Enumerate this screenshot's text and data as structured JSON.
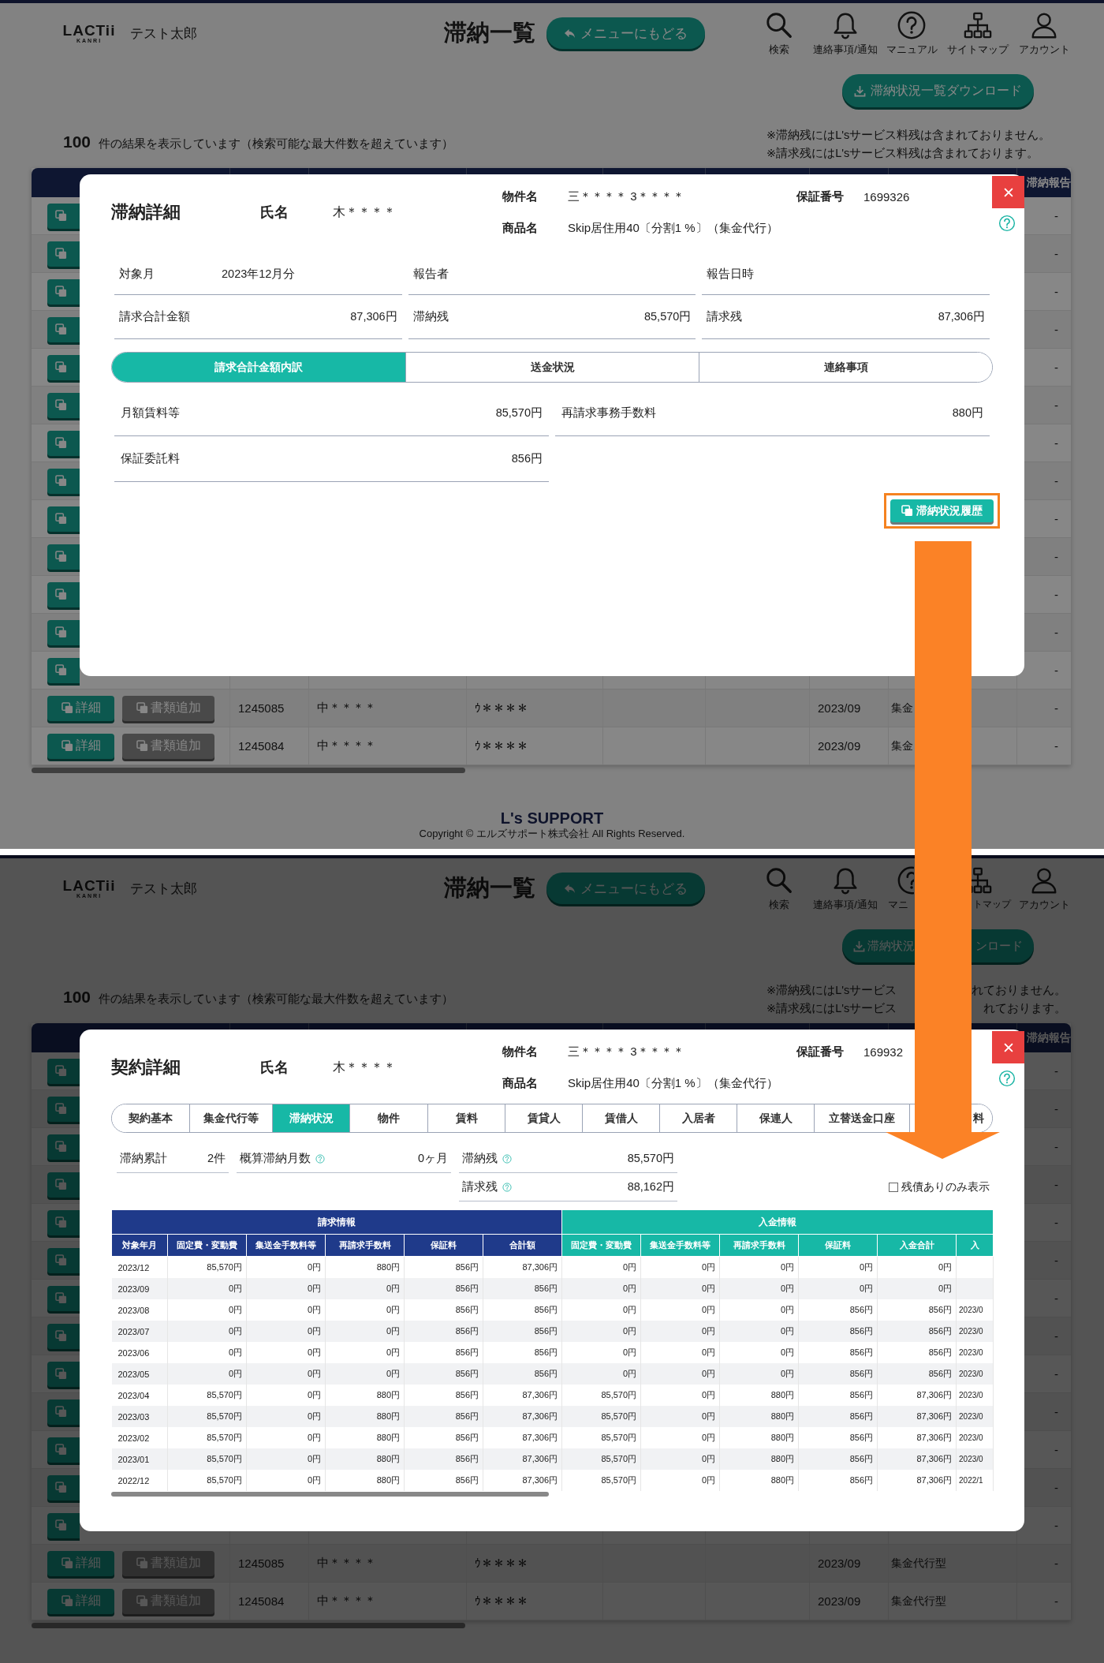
{
  "panels": [
    {
      "header": {
        "logo": "LACTii",
        "logo_sub": "KANRI",
        "user": "テスト太郎",
        "title": "滞納一覧",
        "back_button": "メニューにもどる",
        "nav": [
          {
            "kind": "search",
            "label": "検索"
          },
          {
            "kind": "bell",
            "label": "連絡事項/通知"
          },
          {
            "kind": "help",
            "label": "マニュアル"
          },
          {
            "kind": "sitemap",
            "label": "サイトマップ"
          },
          {
            "kind": "account",
            "label": "アカウント"
          }
        ]
      },
      "download_button": [
        "滞納状況一覧ダウンロード"
      ],
      "result_text": "**100** 件の結果を表示しています（検索可能な最大件数を超えています）",
      "notes": [
        [
          "※滞納残にはL'sサービス料残は含まれておりません。"
        ],
        [
          "※請求残にはL'sサービス料残は含まれております。"
        ]
      ],
      "table": {
        "column_9": "滞納報告",
        "rows": [
          {
            "kind": "covered",
            "status": "-"
          },
          {
            "kind": "covered",
            "status": "-"
          },
          {
            "kind": "covered",
            "status": "-"
          },
          {
            "kind": "covered",
            "status": "-"
          },
          {
            "kind": "covered",
            "status": "-"
          },
          {
            "kind": "covered",
            "status": "-"
          },
          {
            "kind": "covered",
            "status": "-"
          },
          {
            "kind": "covered",
            "status": "-"
          },
          {
            "kind": "covered",
            "status": "-"
          },
          {
            "kind": "covered",
            "status": "-"
          },
          {
            "kind": "covered",
            "status": "-"
          },
          {
            "kind": "covered",
            "status": "-"
          },
          {
            "kind": "covered",
            "status": "-"
          },
          {
            "kind": "full",
            "detail": "詳細",
            "docs": "書類追加",
            "id": "1245085",
            "name": "中＊＊＊＊",
            "property": "ｳ＊＊＊＊",
            "date": "2023/09",
            "type": "集金",
            "status": "-"
          },
          {
            "kind": "full",
            "detail": "詳細",
            "docs": "書類追加",
            "id": "1245084",
            "name": "中＊＊＊＊",
            "property": "ｳ＊＊＊＊",
            "date": "2023/09",
            "type": "集金",
            "status": "-"
          }
        ]
      },
      "footer": {
        "logo": "L's SUPPORT",
        "copyright": "Copyright © エルズサポート株式会社 All Rights Reserved."
      },
      "modal": {
        "kind": "billing",
        "title": "滞納詳細",
        "name_label": "氏名",
        "name": "木＊＊＊＊",
        "property_label": "物件名",
        "property": "三＊＊＊＊ 3＊＊＊＊",
        "product_label": "商品名",
        "product": "Skip居住用40〔分割1 %〕（集金代行）",
        "guarantee_label": "保証番号",
        "guarantee_no": "1699326",
        "info": [
          {
            "kind": "inline",
            "label": "対象月",
            "value": "2023年12月分"
          },
          {
            "kind": "amount",
            "label": "報告者"
          },
          {
            "kind": "amount",
            "label": "報告日時"
          },
          {
            "kind": "amount",
            "label": "請求合計金額",
            "value": "87,306円"
          },
          {
            "kind": "amount",
            "label": "滞納残",
            "value": "85,570円"
          },
          {
            "kind": "amount",
            "label": "請求残",
            "value": "87,306円"
          }
        ],
        "tabs": [
          {
            "label": "請求合計金額内訳",
            "selected": true
          },
          {
            "label": "送金状況",
            "selected": false
          },
          {
            "label": "連絡事項",
            "selected": false
          }
        ],
        "details": [
          {
            "label": "月額賃料等",
            "value": "85,570円"
          },
          {
            "label": "再請求事務手数料",
            "value": "880円"
          },
          {
            "label": "保証委託料",
            "value": "856円"
          }
        ],
        "history_button": {
          "label": "滞納状況履歴",
          "highlighted": true
        }
      }
    },
    {
      "header": {
        "logo": "LACTii",
        "logo_sub": "KANRI",
        "user": "テスト太郎",
        "title": "滞納一覧",
        "back_button": "メニューにもどる",
        "nav": [
          {
            "kind": "search",
            "label": "検索"
          },
          {
            "kind": "bell",
            "label": "連絡事項/通知"
          },
          {
            "kind": "help",
            "label": "マニ"
          },
          {
            "kind": "sitemap",
            "label": "トマップ"
          },
          {
            "kind": "account",
            "label": "アカウント"
          }
        ]
      },
      "download_button": [
        "滞納状況",
        "ンロード"
      ],
      "result_text": "**100** 件の結果を表示しています（検索可能な最大件数を超えています）",
      "notes": [
        [
          "※滞納残にはL'sサービス",
          "れておりません。"
        ],
        [
          "※請求残にはL'sサービス",
          "れております。"
        ]
      ],
      "table": {
        "column_9": "滞納報告",
        "rows": [
          {
            "kind": "covered",
            "status": "-"
          },
          {
            "kind": "covered",
            "status": "-"
          },
          {
            "kind": "covered",
            "status": "-"
          },
          {
            "kind": "covered",
            "status": "-"
          },
          {
            "kind": "covered",
            "status": "-"
          },
          {
            "kind": "covered",
            "status": "-"
          },
          {
            "kind": "covered",
            "status": "-"
          },
          {
            "kind": "covered",
            "status": "-"
          },
          {
            "kind": "covered",
            "status": "-"
          },
          {
            "kind": "covered",
            "status": "-"
          },
          {
            "kind": "covered",
            "status": "-"
          },
          {
            "kind": "covered",
            "status": "-"
          },
          {
            "kind": "covered",
            "status": "-"
          },
          {
            "kind": "full",
            "detail": "詳細",
            "docs": "書類追加",
            "id": "1245085",
            "name": "中＊＊＊＊",
            "property": "ｳ＊＊＊＊",
            "date": "2023/09",
            "type": "集金代行型",
            "status": "-"
          },
          {
            "kind": "full",
            "detail": "詳細",
            "docs": "書類追加",
            "id": "1245084",
            "name": "中＊＊＊＊",
            "property": "ｳ＊＊＊＊",
            "date": "2023/09",
            "type": "集金代行型",
            "status": "-"
          }
        ]
      },
      "modal": {
        "kind": "contract",
        "title": "契約詳細",
        "name_label": "氏名",
        "name": "木＊＊＊＊",
        "property_label": "物件名",
        "property": "三＊＊＊＊ 3＊＊＊＊",
        "product_label": "商品名",
        "product": "Skip居住用40〔分割1 %〕（集金代行）",
        "guarantee_label": "保証番号",
        "guarantee_no": "169932",
        "tabs": [
          {
            "label": "契約基本",
            "selected": false
          },
          {
            "label": "集金代行等",
            "selected": false
          },
          {
            "label": "滞納状況",
            "selected": true
          },
          {
            "label": "物件",
            "selected": false
          },
          {
            "label": "賃料",
            "selected": false
          },
          {
            "label": "賃貸人",
            "selected": false
          },
          {
            "label": "賃借人",
            "selected": false
          },
          {
            "label": "入居者",
            "selected": false
          },
          {
            "label": "保連人",
            "selected": false
          },
          {
            "label": "立替送金口座",
            "selected": false
          },
          {
            "label": "料",
            "selected": false
          }
        ],
        "summary": [
          {
            "label": "滞納累計",
            "value": "2件",
            "help": false
          },
          {
            "label": "概算滞納月数",
            "value": "0ヶ月",
            "help": true
          },
          {
            "label": "滞納残",
            "value": "85,570円",
            "help": true
          },
          {
            "label": "請求残",
            "value": "88,162円",
            "help": true
          }
        ],
        "checkbox": {
          "label": "残債ありのみ表示",
          "checked": false
        },
        "table": {
          "groups": [
            {
              "kind": "billing",
              "label": "請求情報",
              "columns": [
                "対象年月",
                "固定費・変動費",
                "集送金手数料等",
                "再請求手数料",
                "保証料",
                "合計額"
              ]
            },
            {
              "kind": "payment",
              "label": "入金情報",
              "columns": [
                "固定費・変動費",
                "集送金手数料等",
                "再請求手数料",
                "保証料",
                "入金合計",
                "入"
              ]
            }
          ],
          "rows": [
            [
              "2023/12",
              "85,570円",
              "0円",
              "880円",
              "856円",
              "87,306円",
              "0円",
              "0円",
              "0円",
              "0円",
              "0円"
            ],
            [
              "2023/09",
              "0円",
              "0円",
              "0円",
              "856円",
              "856円",
              "0円",
              "0円",
              "0円",
              "0円",
              "0円"
            ],
            [
              "2023/08",
              "0円",
              "0円",
              "0円",
              "856円",
              "856円",
              "0円",
              "0円",
              "0円",
              "856円",
              "856円",
              "2023/0"
            ],
            [
              "2023/07",
              "0円",
              "0円",
              "0円",
              "856円",
              "856円",
              "0円",
              "0円",
              "0円",
              "856円",
              "856円",
              "2023/0"
            ],
            [
              "2023/06",
              "0円",
              "0円",
              "0円",
              "856円",
              "856円",
              "0円",
              "0円",
              "0円",
              "856円",
              "856円",
              "2023/0"
            ],
            [
              "2023/05",
              "0円",
              "0円",
              "0円",
              "856円",
              "856円",
              "0円",
              "0円",
              "0円",
              "856円",
              "856円",
              "2023/0"
            ],
            [
              "2023/04",
              "85,570円",
              "0円",
              "880円",
              "856円",
              "87,306円",
              "85,570円",
              "0円",
              "880円",
              "856円",
              "87,306円",
              "2023/0"
            ],
            [
              "2023/03",
              "85,570円",
              "0円",
              "880円",
              "856円",
              "87,306円",
              "85,570円",
              "0円",
              "880円",
              "856円",
              "87,306円",
              "2023/0"
            ],
            [
              "2023/02",
              "85,570円",
              "0円",
              "880円",
              "856円",
              "87,306円",
              "85,570円",
              "0円",
              "880円",
              "856円",
              "87,306円",
              "2023/0"
            ],
            [
              "2023/01",
              "85,570円",
              "0円",
              "880円",
              "856円",
              "87,306円",
              "85,570円",
              "0円",
              "880円",
              "856円",
              "87,306円",
              "2023/0"
            ],
            [
              "2022/12",
              "85,570円",
              "0円",
              "880円",
              "856円",
              "87,306円",
              "85,570円",
              "0円",
              "880円",
              "856円",
              "87,306円",
              "2022/1"
            ]
          ]
        }
      }
    }
  ]
}
